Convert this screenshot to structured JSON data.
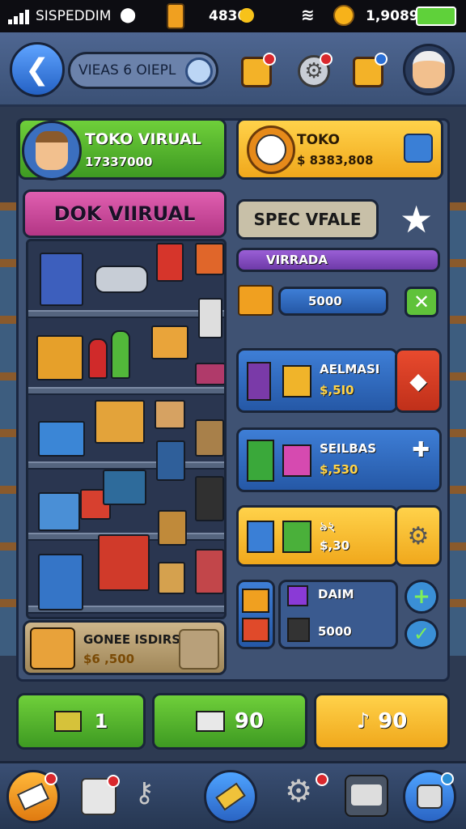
{
  "status": {
    "carrier": "SISPEDDIM",
    "battery_text": "4830",
    "money_text": "1,9089"
  },
  "header": {
    "title": "VIEAS 6 OIEPL"
  },
  "profile": {
    "name": "TOKO VIRUAL",
    "amount": "17337000"
  },
  "store_card": {
    "title": "TOKO",
    "amount": "$ 8383,808"
  },
  "shop_title": "DOK VIIRUAL",
  "spec_label": "SPEC VFALE",
  "category_label": "VIRRADA",
  "stock_value": "5000",
  "items": [
    {
      "title": "AELMASI",
      "price": "$,5I0"
    },
    {
      "title": "SEILBAS",
      "price": "$,530"
    },
    {
      "title": "৯২",
      "price": "$,30"
    },
    {
      "title": "DAIM",
      "price": "5000"
    }
  ],
  "featured": {
    "title": "GONEE ISDIRS",
    "price": "$6 ,500"
  },
  "actions": [
    {
      "label": "1"
    },
    {
      "label": "90"
    },
    {
      "label": "90"
    }
  ],
  "colors": {
    "accent_green": "#4caf2a",
    "accent_yellow": "#f5b82a",
    "accent_blue": "#2e6bc4",
    "panel": "#3f5273"
  }
}
